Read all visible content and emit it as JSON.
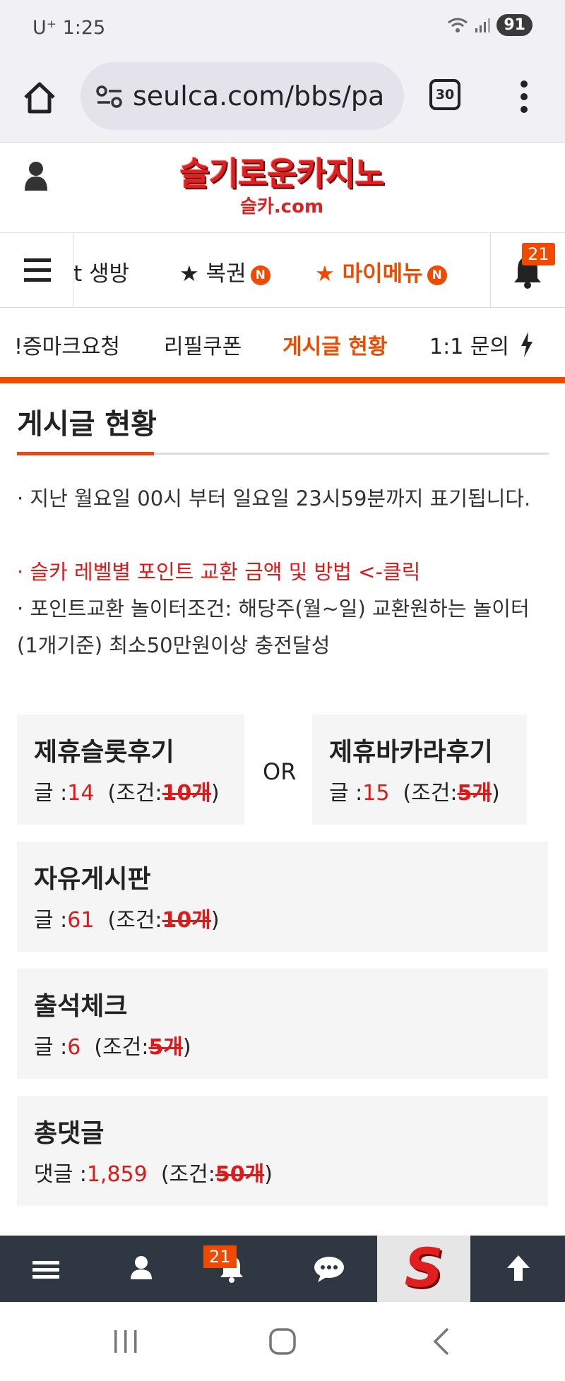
{
  "status": {
    "carrier": "U⁺ 1:25",
    "battery": "91"
  },
  "browser": {
    "url": "seulca.com/bbs/pa",
    "tab_count": "30"
  },
  "logo": {
    "main": "슬기로운카지노",
    "sub": "슬카.com"
  },
  "nav": {
    "items": [
      {
        "label": "t 생방"
      },
      {
        "label": "★ 복권",
        "badge": "N"
      },
      {
        "label": "★ 마이메뉴",
        "badge": "N"
      }
    ],
    "notification_count": "21"
  },
  "subnav": {
    "items": [
      "!증마크요청",
      "리필쿠폰",
      "게시글 현황",
      "1:1 문의"
    ],
    "active_index": 2
  },
  "page": {
    "title": "게시글 현황",
    "notices": [
      "· 지난 월요일 00시 부터 일요일 23시59분까지 표기됩니다.",
      "· 슬카 레벨별 포인트 교환 금액 및 방법 <-클릭",
      "· 포인트교환 놀이터조건: 해당주(월~일) 교환원하는 놀이터(1개기준) 최소50만원이상 충전달성"
    ]
  },
  "stats": {
    "or_label": "OR",
    "slot": {
      "title": "제휴슬롯후기",
      "prefix": "글 :",
      "count": "14",
      "cond_prefix": "(조건:",
      "cond": "10개",
      "cond_suffix": ")"
    },
    "baccarat": {
      "title": "제휴바카라후기",
      "prefix": "글 :",
      "count": "15",
      "cond_prefix": "(조건:",
      "cond": "5개",
      "cond_suffix": ")"
    },
    "free": {
      "title": "자유게시판",
      "prefix": "글 :",
      "count": "61",
      "cond_prefix": "(조건:",
      "cond": "10개",
      "cond_suffix": ")"
    },
    "attendance": {
      "title": "출석체크",
      "prefix": "글 :",
      "count": "6",
      "cond_prefix": "(조건:",
      "cond": "5개",
      "cond_suffix": ")"
    },
    "comments": {
      "title": "총댓글",
      "prefix": "댓글 :",
      "count": "1,859",
      "cond_prefix": "(조건:",
      "cond": "50개",
      "cond_suffix": ")"
    }
  },
  "bottom_bar": {
    "notification_count": "21",
    "logo_letter": "S"
  },
  "colors": {
    "accent": "#f04a00",
    "red": "#e01818",
    "toolbar": "#2f3742"
  }
}
